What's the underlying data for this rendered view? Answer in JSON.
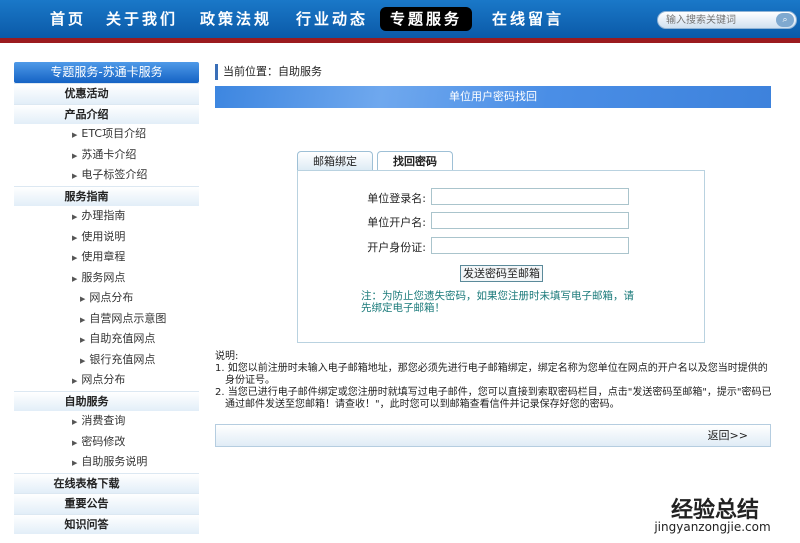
{
  "nav": {
    "items": [
      "首页",
      "关于我们",
      "政策法规",
      "行业动态",
      "专题服务",
      "在线留言"
    ],
    "active": 4,
    "search_placeholder": "输入搜索关键词"
  },
  "sidebar": {
    "title": "专题服务-苏通卡服务",
    "items": [
      {
        "type": "cat",
        "label": "优惠活动"
      },
      {
        "type": "cat",
        "label": "产品介绍"
      },
      {
        "type": "sub",
        "label": "ETC项目介绍"
      },
      {
        "type": "sub",
        "label": "苏通卡介绍"
      },
      {
        "type": "sub",
        "label": "电子标签介绍"
      },
      {
        "type": "cat",
        "label": "服务指南"
      },
      {
        "type": "sub",
        "label": "办理指南"
      },
      {
        "type": "sub",
        "label": "使用说明"
      },
      {
        "type": "sub",
        "label": "使用章程"
      },
      {
        "type": "sub",
        "label": "服务网点"
      },
      {
        "type": "sub2",
        "label": "网点分布"
      },
      {
        "type": "sub2",
        "label": "自营网点示意图"
      },
      {
        "type": "sub2",
        "label": "自助充值网点"
      },
      {
        "type": "sub2",
        "label": "银行充值网点"
      },
      {
        "type": "sub",
        "label": "网点分布"
      },
      {
        "type": "cat",
        "label": "自助服务"
      },
      {
        "type": "sub",
        "label": "消费查询"
      },
      {
        "type": "sub",
        "label": "密码修改"
      },
      {
        "type": "sub",
        "label": "自助服务说明"
      },
      {
        "type": "cat",
        "label": "在线表格下载"
      },
      {
        "type": "cat",
        "label": "重要公告"
      },
      {
        "type": "cat",
        "label": "知识问答"
      }
    ]
  },
  "main": {
    "breadcrumb": "当前位置：自助服务",
    "title": "单位用户密码找回",
    "tabs": [
      "邮箱绑定",
      "找回密码"
    ],
    "fields": [
      "单位登录名:",
      "单位开户名:",
      "开户身份证:"
    ],
    "send_button": "发送密码至邮箱",
    "note": "注：为防止您遗失密码，如果您注册时未填写电子邮箱，请先绑定电子邮箱！",
    "desc_title": "说明:",
    "desc": [
      "1. 如您以前注册时未输入电子邮箱地址，那您必须先进行电子邮箱绑定，绑定名称为您单位在网点的开户名以及您当时提供的身份证号。",
      "2. 当您已进行电子邮件绑定或您注册时就填写过电子邮件，您可以直接到索取密码栏目，点击\"发送密码至邮箱\"，提示\"密码已通过邮件发送至您邮箱！请查收！\"，此时您可以到邮箱查看信件并记录保存好您的密码。"
    ],
    "return": "返回>>"
  },
  "watermark": {
    "title": "经验总结",
    "url": "jingyanzongjie.com"
  }
}
